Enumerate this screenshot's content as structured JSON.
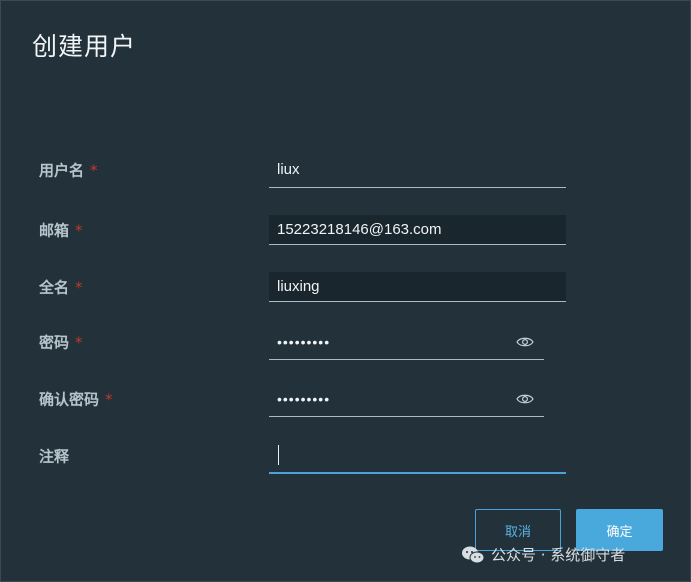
{
  "dialog": {
    "title": "创建用户"
  },
  "form": {
    "username": {
      "label": "用户名",
      "required": "*",
      "value": "liux"
    },
    "email": {
      "label": "邮箱",
      "required": "*",
      "value": "15223218146@163.com"
    },
    "fullname": {
      "label": "全名",
      "required": "*",
      "value": "liuxing"
    },
    "password": {
      "label": "密码",
      "required": "*",
      "masked": "•••••••••"
    },
    "confirm_password": {
      "label": "确认密码",
      "required": "*",
      "masked": "•••••••••"
    },
    "comment": {
      "label": "注释",
      "value": ""
    }
  },
  "buttons": {
    "cancel": "取消",
    "ok": "确定"
  },
  "watermark": {
    "text": "公众号 · 系统御守者"
  },
  "colors": {
    "accent": "#49a8dc",
    "required": "#c0392b",
    "background": "#22313a"
  }
}
